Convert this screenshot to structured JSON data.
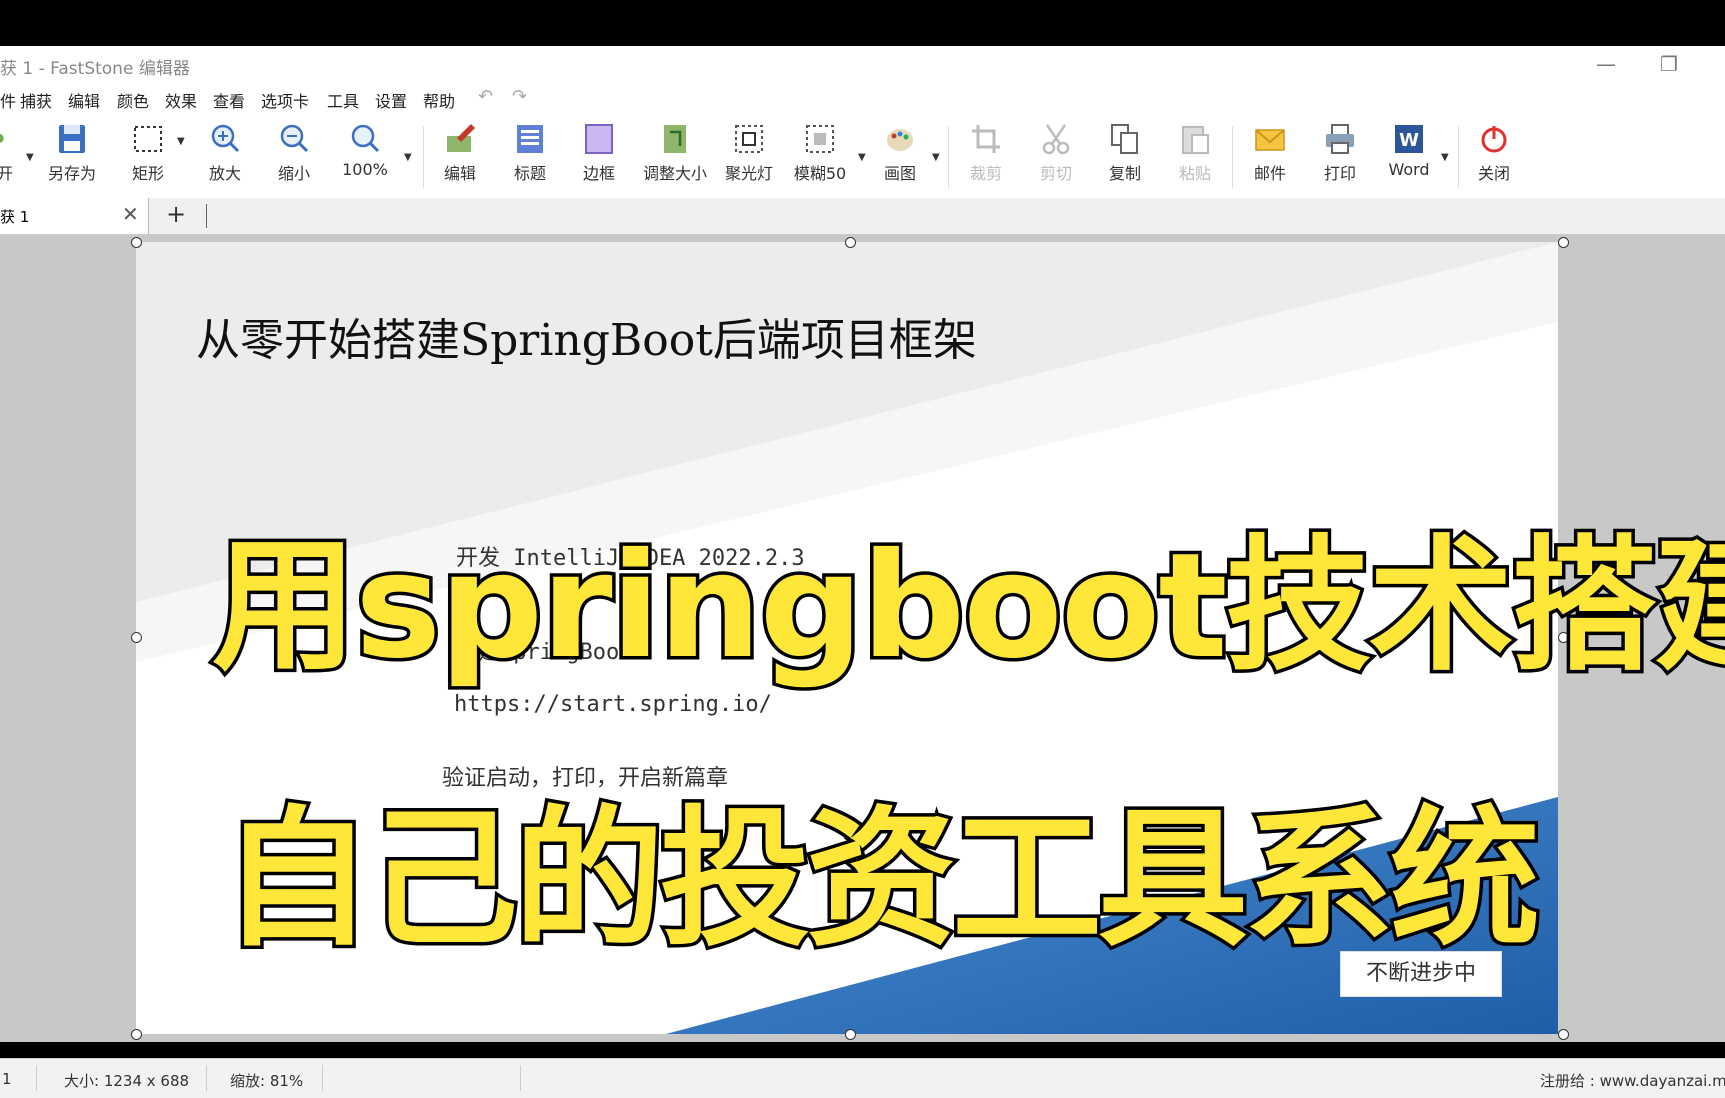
{
  "window": {
    "title": "获 1 - FastStone 编辑器",
    "minimize": "—",
    "restore": "❐"
  },
  "menu": [
    "件",
    "捕获",
    "编辑",
    "颜色",
    "效果",
    "查看",
    "选项卡",
    "工具",
    "设置",
    "帮助"
  ],
  "toolbar": {
    "open": "开",
    "save_as": "另存为",
    "rectangle": "矩形",
    "zoom_in": "放大",
    "zoom_out": "缩小",
    "zoom_level": "100%",
    "edit": "编辑",
    "caption": "标题",
    "border": "边框",
    "resize": "调整大小",
    "spotlight": "聚光灯",
    "blur": "模糊50",
    "draw": "画图",
    "crop": "裁剪",
    "cut": "剪切",
    "copy": "复制",
    "paste": "粘贴",
    "email": "邮件",
    "print": "打印",
    "word": "Word",
    "close": "关闭"
  },
  "tabs": {
    "active_label": "获 1",
    "close": "✕",
    "add": "+"
  },
  "document": {
    "title": "从零开始搭建SpringBoot后端项目框架",
    "line1": "开发  IntelliJ IDEA 2022.2.3",
    "line2": "创建SpringBoot",
    "line3": "https://start.spring.io/",
    "line4": "验证启动，打印，开启新篇章",
    "badge": "不断进步中"
  },
  "overlay": {
    "line1": "用springboot技术搭建",
    "line2": "自己的投资工具系统"
  },
  "status": {
    "page": "1",
    "size": "大小: 1234 x 688",
    "zoom": "缩放: 81%",
    "registered": "注册给 : www.dayanzai.m"
  },
  "colors": {
    "overlay_text": "#ffe73a",
    "overlay_stroke": "#000000",
    "doc_blue": "#2a6fb8"
  }
}
